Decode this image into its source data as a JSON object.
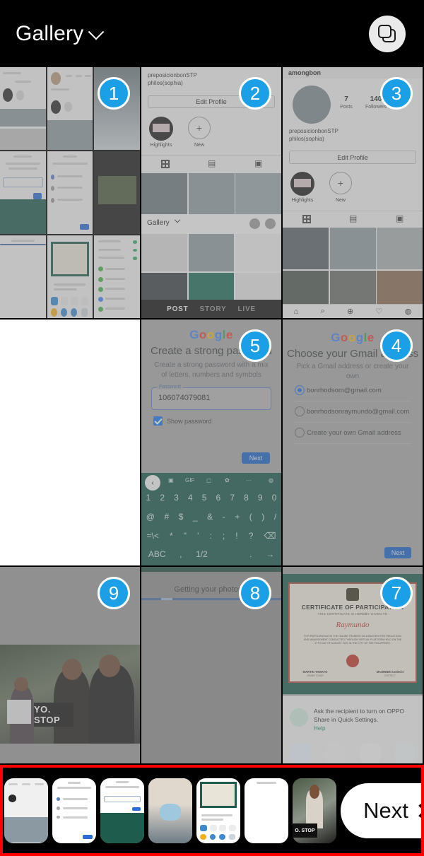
{
  "header": {
    "title": "Gallery",
    "chevron_icon": "chevron-down-icon",
    "multiselect_icon": "layers-icon"
  },
  "grid": {
    "cells": [
      {
        "badge": "1",
        "kind": "screenshot-collage",
        "description": "Collage of nine phone screenshots"
      },
      {
        "badge": "2",
        "kind": "instagram-profile",
        "edit_profile": "Edit Profile",
        "bio_line1": "preposicionbonSTP",
        "bio_line2": "philos(sophia)",
        "highlights_label": "Highlights",
        "new_label": "New",
        "gallery_label": "Gallery",
        "post": "POST",
        "story": "STORY",
        "live": "LIVE"
      },
      {
        "badge": "3",
        "kind": "instagram-profile",
        "username": "amongbon",
        "posts_count": "7",
        "posts_label": "Posts",
        "followers_count": "140",
        "followers_label": "Followers",
        "bio_line1": "preposicionbonSTP",
        "bio_line2": "philos(sophia)",
        "edit_profile": "Edit Profile",
        "highlights_label": "Highlights",
        "new_label": "New"
      },
      {
        "badge": "",
        "kind": "blank-white"
      },
      {
        "badge": "5",
        "kind": "google-password",
        "brand": "Google",
        "title": "Create a strong password",
        "subtitle": "Create a strong password with a mix of letters, numbers and symbols",
        "field_label": "Password",
        "field_value": "106074079081",
        "checkbox_label": "Show password",
        "next_label": "Next",
        "keyboard_numbers": [
          "1",
          "2",
          "3",
          "4",
          "5",
          "6",
          "7",
          "8",
          "9",
          "0"
        ],
        "keyboard_symbols": [
          "@",
          "#",
          "$",
          "_",
          "&",
          "-",
          "+",
          "(",
          ")",
          "/"
        ],
        "keyboard_symbols2": [
          "=\\<",
          "*",
          "\"",
          "'",
          ":",
          ";",
          "!",
          "?"
        ],
        "keyboard_bottom": [
          "ABC",
          ",",
          "1/2"
        ],
        "keyboard_tools": [
          "GIF"
        ]
      },
      {
        "badge": "4",
        "kind": "google-gmail-choice",
        "brand": "Google",
        "title": "Choose your Gmail address",
        "subtitle": "Pick a Gmail address or create your own",
        "options": [
          "bonrhodsom@gmail.com",
          "bonrhodsonraymundo@gmail.com",
          "Create your own Gmail address"
        ],
        "selected_index": 0,
        "next_label": "Next"
      },
      {
        "badge": "9",
        "kind": "photo-protest",
        "sign_text": "YO. STOP"
      },
      {
        "badge": "8",
        "kind": "loading",
        "status_text": "Getting your photos..."
      },
      {
        "badge": "7",
        "kind": "certificate-share",
        "cert_title": "CERTIFICATE OF PARTICIPATION",
        "cert_subtitle": "THIS CERTIFICATE IS HEREBY GIVEN TO",
        "cert_name": "Raymundo",
        "cert_body": "FOR PARTICIPATING IN THE ONLINE TRAINING ON DISASTER RISK REDUCTION AND MANAGEMENT CONDUCTED THROUGH VIRTUAL PLATFORM HELD ON THE 17TH DAY OF AUGUST 2021 IN THE CITY OF THE PHILIPPINES.",
        "sig_left": "MARTIN TAMAYO",
        "sig_left_sub": "GRANT CHAIR",
        "sig_right": "MAUREEN COSICO",
        "sig_right_sub": "DISTRICT",
        "share_text": "Ask the recipient to turn on OPPO Share in Quick Settings.",
        "share_help": "Help"
      }
    ]
  },
  "filmstrip": {
    "thumbnail_count": 7,
    "next_label": "Next",
    "next_icon": "chevron-right-icon"
  },
  "colors": {
    "badge_blue": "#1ba0e8",
    "highlight_red": "#ff0000",
    "header_bg": "#000000",
    "button_white": "#ffffff"
  }
}
